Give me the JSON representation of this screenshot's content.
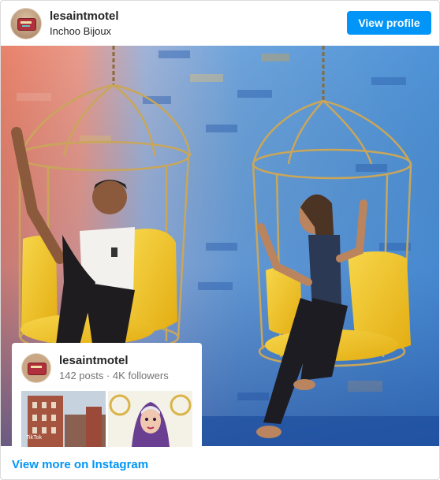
{
  "header": {
    "username": "lesaintmotel",
    "sublabel": "Inchoo Bijoux",
    "view_profile_label": "View profile"
  },
  "card": {
    "username": "lesaintmotel",
    "stats": "142 posts · 4K followers",
    "thumb1_caption": "TikTok"
  },
  "footer": {
    "link_label": "View more on Instagram"
  },
  "colors": {
    "button_blue": "#0095f6",
    "text_dark": "#262626",
    "text_muted": "#737373",
    "cushion_yellow": "#f3c72a",
    "cage_gold": "#c9a65a",
    "wall_blue": "#3f7ecb"
  },
  "icons": {
    "avatar": "motel-sign-avatar"
  }
}
